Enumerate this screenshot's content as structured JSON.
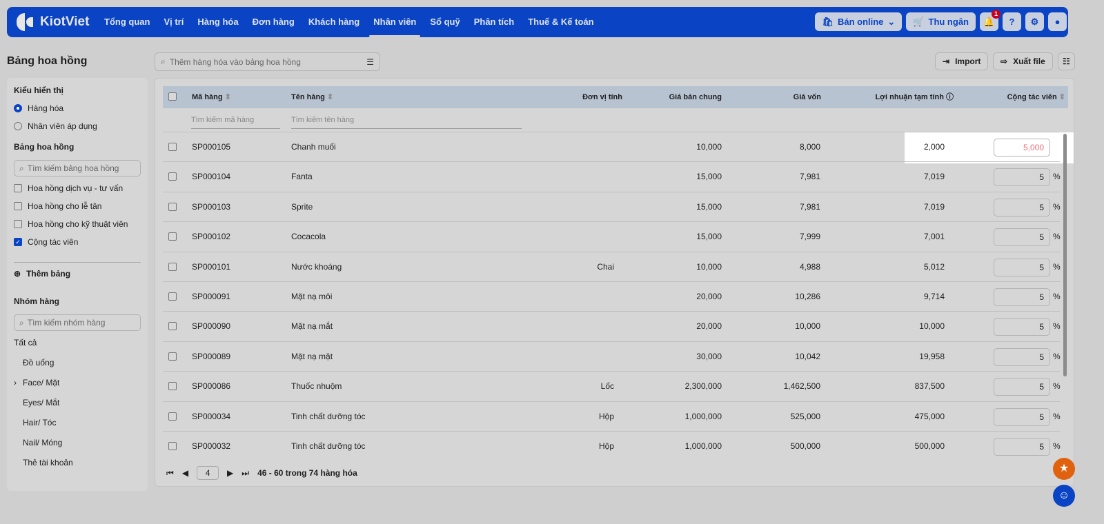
{
  "nav": {
    "brand": "KiotViet",
    "menu": [
      "Tổng quan",
      "Vị trí",
      "Hàng hóa",
      "Đơn hàng",
      "Khách hàng",
      "Nhân viên",
      "Sổ quỹ",
      "Phân tích",
      "Thuế & Kế toán"
    ],
    "active": "Nhân viên",
    "ban_online": "Bán online",
    "thu_ngan": "Thu ngân",
    "notif_count": "1"
  },
  "page": {
    "title": "Bảng hoa hồng",
    "search_placeholder": "Thêm hàng hóa vào bảng hoa hồng",
    "import": "Import",
    "export": "Xuất file"
  },
  "sidebar": {
    "display_title": "Kiểu hiển thị",
    "display_options": [
      "Hàng hóa",
      "Nhân viên áp dụng"
    ],
    "table_title": "Bảng hoa hồng",
    "table_search": "Tìm kiếm bảng hoa hồng",
    "tables": [
      {
        "label": "Hoa hồng dịch vụ - tư vấn",
        "checked": false
      },
      {
        "label": "Hoa hồng cho lễ tân",
        "checked": false
      },
      {
        "label": "Hoa hồng cho kỹ thuật viên",
        "checked": false
      },
      {
        "label": "Cộng tác viên",
        "checked": true
      }
    ],
    "add_table": "Thêm bảng",
    "group_title": "Nhóm hàng",
    "group_search": "Tìm kiếm nhóm hàng",
    "group_all": "Tất cả",
    "groups": [
      "Đồ uống",
      "Face/ Mặt",
      "Eyes/ Mắt",
      "Hair/ Tóc",
      "Nail/ Móng",
      "Thẻ tài khoản"
    ]
  },
  "table": {
    "headers": {
      "code": "Mã hàng",
      "name": "Tên hàng",
      "unit": "Đơn vị tính",
      "price": "Giá bán chung",
      "cost": "Giá vốn",
      "profit": "Lợi nhuận tạm tính",
      "commission": "Cộng tác viên"
    },
    "filter_code": "Tìm kiếm mã hàng",
    "filter_name": "Tìm kiếm tên hàng",
    "rows": [
      {
        "code": "SP000105",
        "name": "Chanh muối",
        "unit": "",
        "price": "10,000",
        "cost": "8,000",
        "profit": "2,000",
        "commission": "5,000",
        "pct": ""
      },
      {
        "code": "SP000104",
        "name": "Fanta",
        "unit": "",
        "price": "15,000",
        "cost": "7,981",
        "profit": "7,019",
        "commission": "5",
        "pct": "%"
      },
      {
        "code": "SP000103",
        "name": "Sprite",
        "unit": "",
        "price": "15,000",
        "cost": "7,981",
        "profit": "7,019",
        "commission": "5",
        "pct": "%"
      },
      {
        "code": "SP000102",
        "name": "Cocacola",
        "unit": "",
        "price": "15,000",
        "cost": "7,999",
        "profit": "7,001",
        "commission": "5",
        "pct": "%"
      },
      {
        "code": "SP000101",
        "name": "Nước khoáng",
        "unit": "Chai",
        "price": "10,000",
        "cost": "4,988",
        "profit": "5,012",
        "commission": "5",
        "pct": "%"
      },
      {
        "code": "SP000091",
        "name": "Mặt nạ môi",
        "unit": "",
        "price": "20,000",
        "cost": "10,286",
        "profit": "9,714",
        "commission": "5",
        "pct": "%"
      },
      {
        "code": "SP000090",
        "name": "Mặt nạ mắt",
        "unit": "",
        "price": "20,000",
        "cost": "10,000",
        "profit": "10,000",
        "commission": "5",
        "pct": "%"
      },
      {
        "code": "SP000089",
        "name": "Mặt nạ mặt",
        "unit": "",
        "price": "30,000",
        "cost": "10,042",
        "profit": "19,958",
        "commission": "5",
        "pct": "%"
      },
      {
        "code": "SP000086",
        "name": "Thuốc nhuộm",
        "unit": "Lốc",
        "price": "2,300,000",
        "cost": "1,462,500",
        "profit": "837,500",
        "commission": "5",
        "pct": "%"
      },
      {
        "code": "SP000034",
        "name": "Tinh chất dưỡng tóc",
        "unit": "Hộp",
        "price": "1,000,000",
        "cost": "525,000",
        "profit": "475,000",
        "commission": "5",
        "pct": "%"
      },
      {
        "code": "SP000032",
        "name": "Tinh chất dưỡng tóc",
        "unit": "Hộp",
        "price": "1,000,000",
        "cost": "500,000",
        "profit": "500,000",
        "commission": "5",
        "pct": "%"
      }
    ]
  },
  "pager": {
    "page": "4",
    "summary": "46 - 60 trong 74 hàng hóa"
  },
  "colors": {
    "brand": "#0a44c4",
    "highlight_value": "#e8707a",
    "fab_star": "#e0620f"
  }
}
